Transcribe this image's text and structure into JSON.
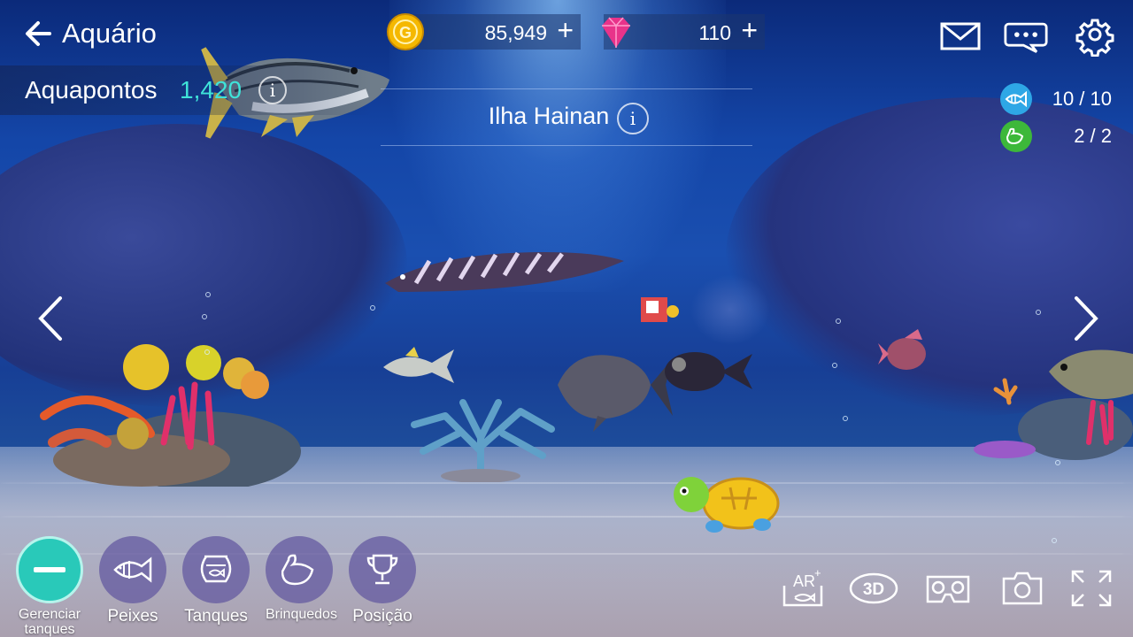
{
  "header": {
    "back_title": "Aquário",
    "coins": "85,949",
    "gems": "110",
    "plus": "+"
  },
  "aquapoints": {
    "label": "Aquapontos",
    "value": "1,420",
    "info": "i"
  },
  "location": {
    "name": "Ilha Hainan",
    "info": "i"
  },
  "capacity": {
    "fish": "10 / 10",
    "decor": "2 / 2"
  },
  "toolbar": {
    "manage": "Gerenciar tanques",
    "fish": "Peixes",
    "tanks": "Tanques",
    "toys": "Brinquedos",
    "ranking": "Posição"
  },
  "view_tools": {
    "ar": "AR",
    "ar_sup": "+",
    "three_d": "3D"
  },
  "colors": {
    "accent_teal": "#29c9b9",
    "aquapoints_value": "#3fe3d9",
    "gem": "#e8338a",
    "coin": "#f5b800"
  }
}
